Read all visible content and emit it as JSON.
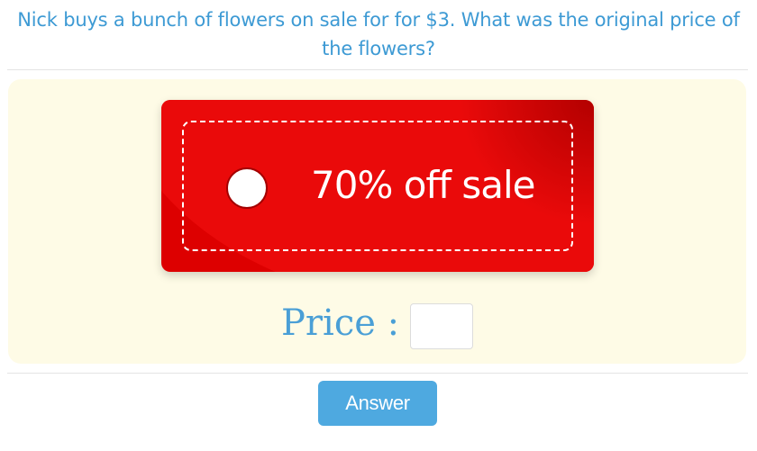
{
  "question": {
    "text": "Nick buys a bunch of flowers on sale for for $3. What was the original price of the flowers?"
  },
  "sale_tag": {
    "text": "70% off sale",
    "color": "#dd0000"
  },
  "price": {
    "label": "Price :",
    "value": ""
  },
  "answer_button": {
    "label": "Answer",
    "color": "#4ea9e0"
  },
  "colors": {
    "question_text": "#3d9ad4",
    "panel_background": "#fefbe6",
    "price_label": "#4a9fd6"
  }
}
